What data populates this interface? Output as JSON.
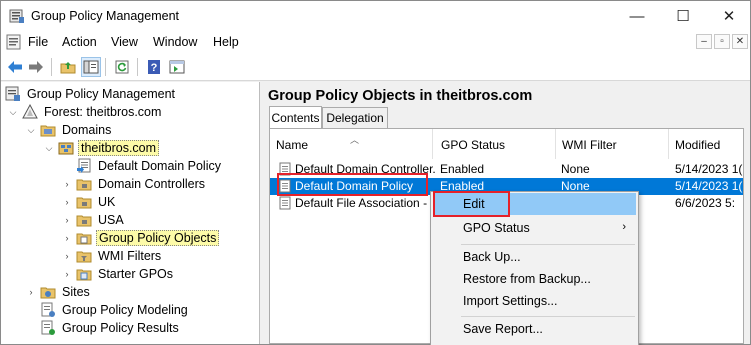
{
  "window": {
    "title": "Group Policy Management",
    "controls": {
      "minimize": "—",
      "maximize": "☐",
      "close": "✕"
    }
  },
  "menubar": {
    "items": [
      "File",
      "Action",
      "View",
      "Window",
      "Help"
    ],
    "mdi_controls": [
      "–",
      "▫",
      "✕"
    ]
  },
  "toolbar": {
    "buttons": [
      "back-icon",
      "forward-icon",
      "up-folder-icon",
      "show-hide-tree-icon",
      "refresh-icon",
      "help-icon",
      "properties-icon"
    ]
  },
  "tree": {
    "root": "Group Policy Management",
    "forest": "Forest: theitbros.com",
    "domains": "Domains",
    "domain": "theitbros.com",
    "children": [
      "Default Domain Policy",
      "Domain Controllers",
      "UK",
      "USA",
      "Group Policy Objects",
      "WMI Filters",
      "Starter GPOs"
    ],
    "sites": "Sites",
    "modeling": "Group Policy Modeling",
    "results": "Group Policy Results"
  },
  "right_pane": {
    "title": "Group Policy Objects in theitbros.com",
    "tabs": [
      "Contents",
      "Delegation"
    ],
    "active_tab": "Contents",
    "columns": [
      "Name",
      "GPO Status",
      "WMI Filter",
      "Modified"
    ],
    "rows": [
      {
        "name": "Default Domain Controller...",
        "status": "Enabled",
        "wmi": "None",
        "modified": "5/14/2023 1("
      },
      {
        "name": "Default Domain Policy",
        "status": "Enabled",
        "wmi": "None",
        "modified": "5/14/2023 1("
      },
      {
        "name": "Default File Association - ...",
        "status": "",
        "wmi": "",
        "modified": "6/6/2023 5:"
      }
    ],
    "selected_row": 1
  },
  "context_menu": {
    "items": [
      "Edit",
      "GPO Status",
      "Back Up...",
      "Restore from Backup...",
      "Import Settings...",
      "Save Report..."
    ],
    "hovered": "Edit",
    "submenu_arrow": "›"
  },
  "colors": {
    "selection": "#0078d7",
    "menu_hover": "#91c9f7",
    "highlight_box": "#e5212a",
    "tree_highlight": "#fdfba8"
  }
}
